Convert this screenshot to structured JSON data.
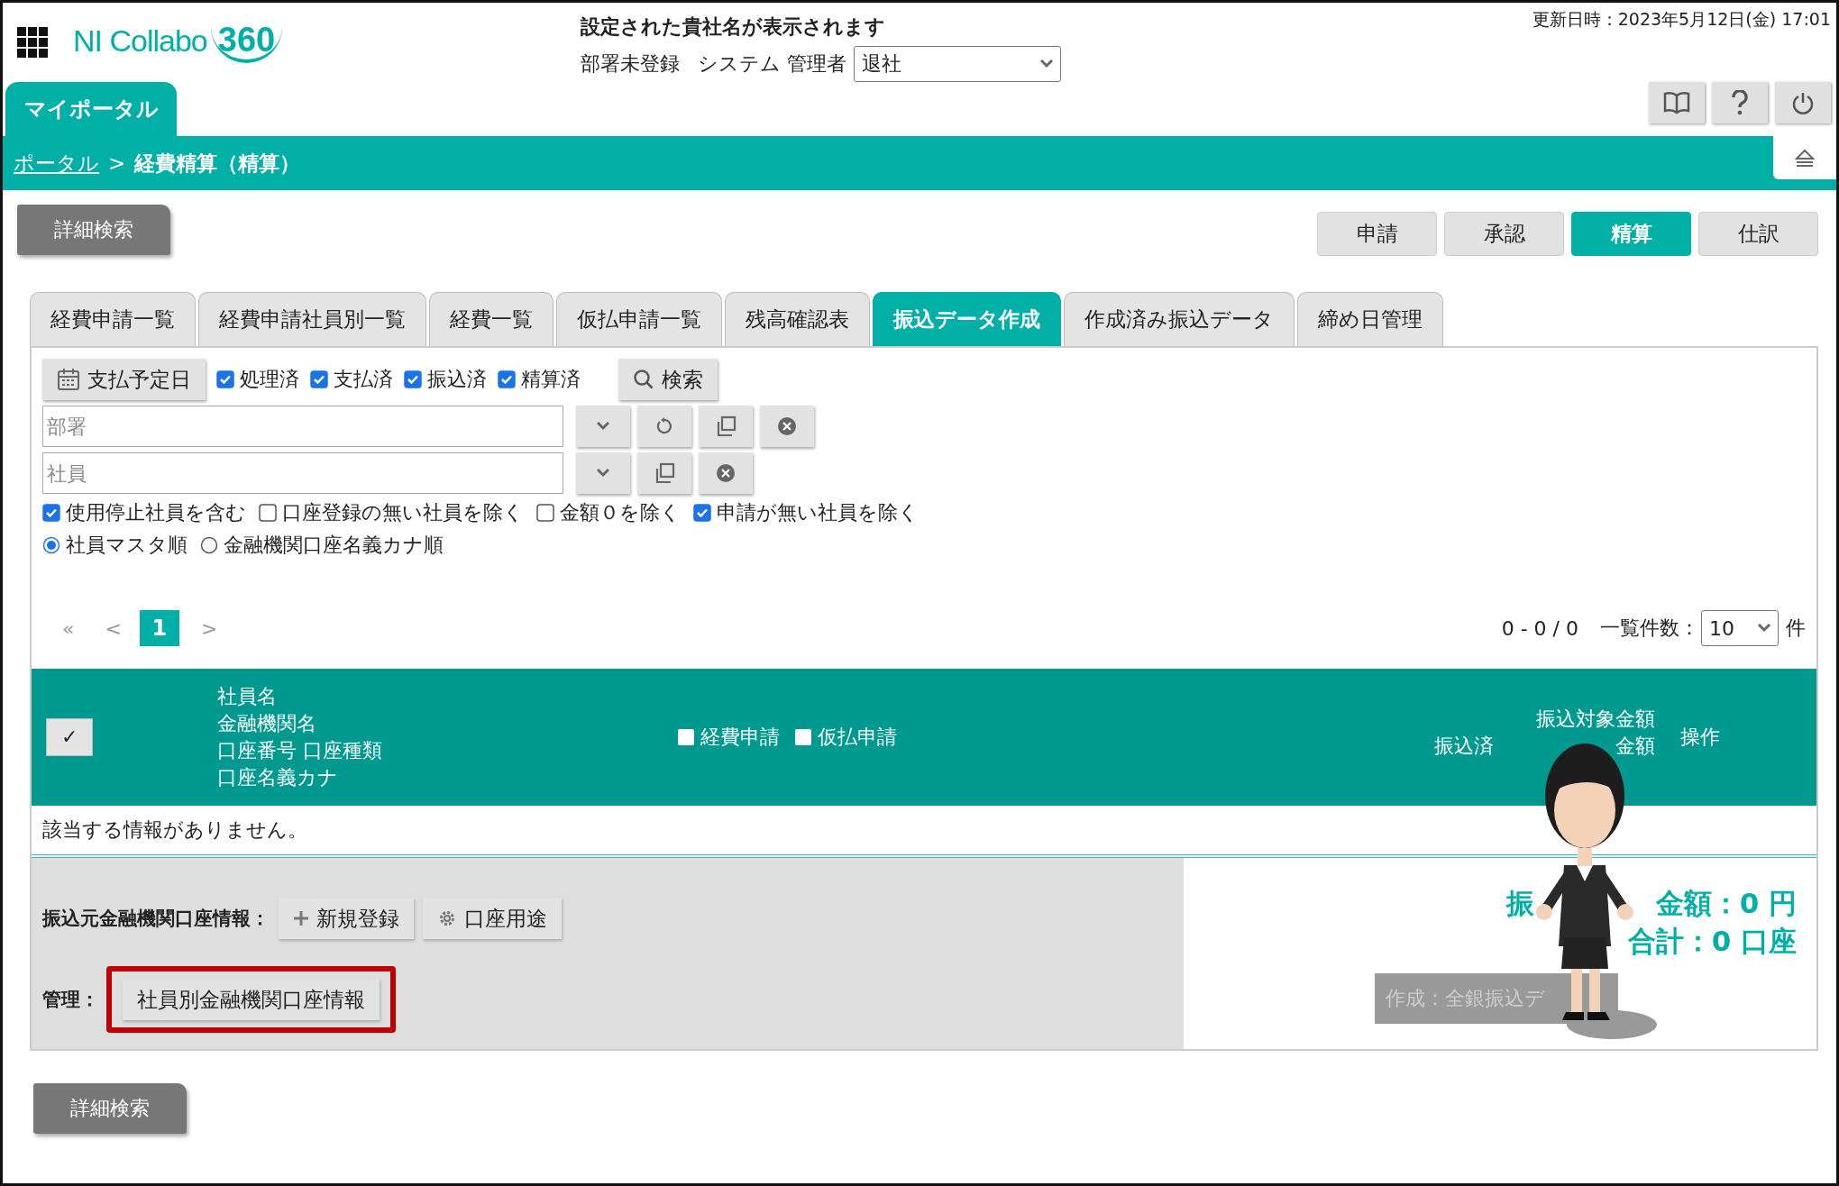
{
  "header": {
    "logo": "NI Collabo",
    "logo_number": "360",
    "company": "設定された貴社名が表示されます",
    "department": "部署未登録",
    "user": "システム 管理者",
    "status_select": "退社",
    "updated": "更新日時：2023年5月12日(金) 17:01"
  },
  "portal_tab": "マイポータル",
  "breadcrumb": {
    "link": "ポータル",
    "separator": ">",
    "current": "経費精算（精算）"
  },
  "detail_search": "詳細検索",
  "modes": [
    {
      "label": "申請",
      "selected": false
    },
    {
      "label": "承認",
      "selected": false
    },
    {
      "label": "精算",
      "selected": true
    },
    {
      "label": "仕訳",
      "selected": false
    }
  ],
  "tabs": [
    {
      "label": "経費申請一覧",
      "selected": false
    },
    {
      "label": "経費申請社員別一覧",
      "selected": false
    },
    {
      "label": "経費一覧",
      "selected": false
    },
    {
      "label": "仮払申請一覧",
      "selected": false
    },
    {
      "label": "残高確認表",
      "selected": false
    },
    {
      "label": "振込データ作成",
      "selected": true
    },
    {
      "label": "作成済み振込データ",
      "selected": false
    },
    {
      "label": "締め日管理",
      "selected": false
    }
  ],
  "filters": {
    "date_button": "支払予定日",
    "status_checks": [
      {
        "label": "処理済",
        "checked": true
      },
      {
        "label": "支払済",
        "checked": true
      },
      {
        "label": "振込済",
        "checked": true
      },
      {
        "label": "精算済",
        "checked": true
      }
    ],
    "search_button": "検索",
    "department": {
      "placeholder": "部署"
    },
    "employee": {
      "placeholder": "社員"
    },
    "options": [
      {
        "label": "使用停止社員を含む",
        "checked": true
      },
      {
        "label": "口座登録の無い社員を除く",
        "checked": false
      },
      {
        "label": "金額０を除く",
        "checked": false
      },
      {
        "label": "申請が無い社員を除く",
        "checked": true
      }
    ],
    "sort": [
      {
        "label": "社員マスタ順",
        "selected": true
      },
      {
        "label": "金融機関口座名義カナ順",
        "selected": false
      }
    ]
  },
  "pagination": {
    "first": "«",
    "prev": "<",
    "pages": [
      {
        "label": "1",
        "selected": true
      }
    ],
    "next": ">",
    "range": "0 - 0 / 0",
    "per_page_label": "一覧件数：",
    "per_page": "10",
    "per_page_unit": "件"
  },
  "table": {
    "select_all": "✓",
    "employee_lines": [
      "社員名",
      "金融機関名",
      "口座番号 口座種類",
      "口座名義カナ"
    ],
    "types": [
      {
        "label": "経費申請",
        "checked": false
      },
      {
        "label": "仮払申請",
        "checked": false
      }
    ],
    "amount_line": "振込対象金額",
    "amount_partial": [
      "振込済",
      "金額"
    ],
    "operation": "操作",
    "empty": "該当する情報がありません。"
  },
  "bottom": {
    "account_label": "振込元金融機関口座情報：",
    "new_button": "新規登録",
    "purpose_button": "口座用途",
    "manage_label": "管理：",
    "employee_accounts_button": "社員別金融機関口座情報",
    "total_amount": [
      "振",
      "金額：0 円"
    ],
    "total_accounts": "合計：0 口座",
    "create_button": {
      "label": "作成：全銀振込デ",
      "disabled": true
    }
  },
  "footer_detail_search": "詳細検索"
}
